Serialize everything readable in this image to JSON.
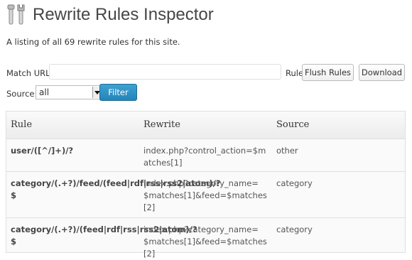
{
  "header": {
    "title": "Rewrite Rules Inspector",
    "icon": "tools-icon"
  },
  "description": "A listing of all 69 rewrite rules for this site.",
  "match": {
    "label": "Match URL:",
    "value": "",
    "placeholder": "",
    "trailing_text": "Rule",
    "flush_label": "Flush Rules",
    "download_label": "Download"
  },
  "source": {
    "label": "Source:",
    "selected": "all",
    "filter_label": "Filter"
  },
  "table": {
    "columns": [
      "Rule",
      "Rewrite",
      "Source"
    ],
    "rows": [
      {
        "rule": "user/([^/]+)/?",
        "rewrite": "index.php?control_action=$matches[1]",
        "source": "other"
      },
      {
        "rule": "category/(.+?)/feed/(feed|rdf|rss|rss2|atom)/?$",
        "rewrite": "index.php?category_name=$matches[1]&feed=$matches[2]",
        "source": "category"
      },
      {
        "rule": "category/(.+?)/(feed|rdf|rss|rss2|atom)/?$",
        "rewrite": "index.php?category_name=$matches[1]&feed=$matches[2]",
        "source": "category"
      }
    ]
  }
}
